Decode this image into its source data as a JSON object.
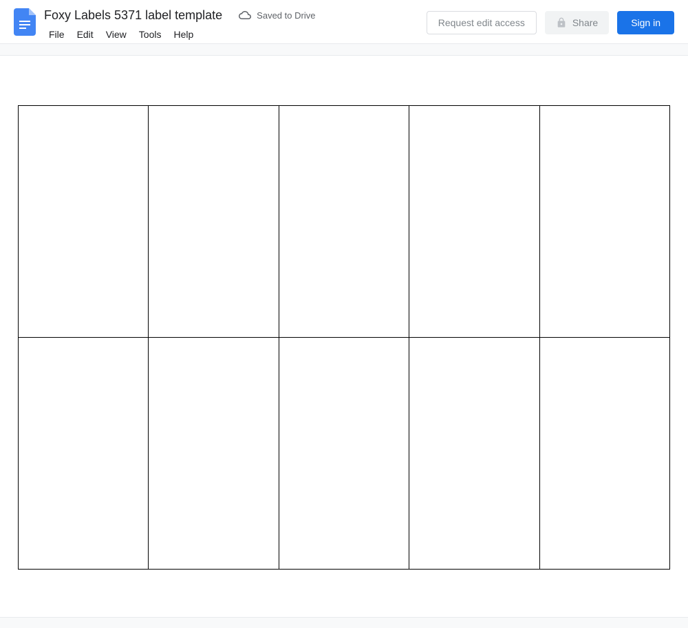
{
  "header": {
    "title": "Foxy Labels 5371 label template",
    "save_status": "Saved to Drive",
    "menu": {
      "file": "File",
      "edit": "Edit",
      "view": "View",
      "tools": "Tools",
      "help": "Help"
    },
    "actions": {
      "request_access": "Request edit access",
      "share": "Share",
      "signin": "Sign in"
    }
  },
  "document": {
    "grid": {
      "rows": 2,
      "cols": 5
    }
  }
}
